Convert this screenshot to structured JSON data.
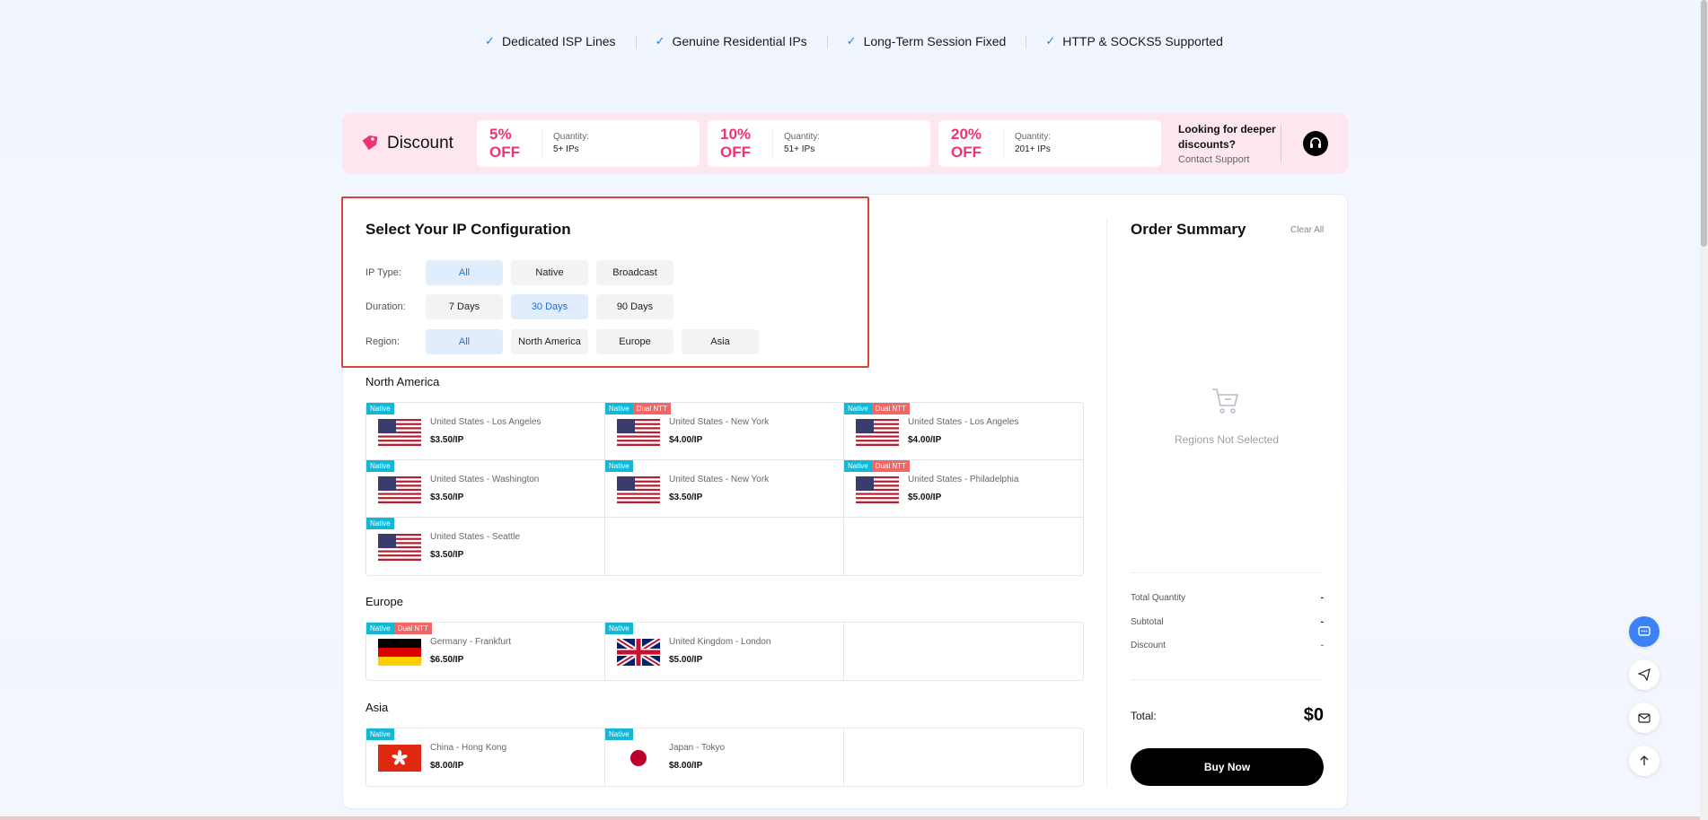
{
  "features": [
    "Dedicated ISP Lines",
    "Genuine Residential IPs",
    "Long-Term Session Fixed",
    "HTTP & SOCKS5 Supported"
  ],
  "discount": {
    "title": "Discount",
    "tiers": [
      {
        "pct": "5% OFF",
        "qty_label": "Quantity:",
        "qty": "5+ IPs"
      },
      {
        "pct": "10% OFF",
        "qty_label": "Quantity:",
        "qty": "51+ IPs"
      },
      {
        "pct": "20% OFF",
        "qty_label": "Quantity:",
        "qty": "201+ IPs"
      }
    ],
    "deeper_title": "Looking for deeper discounts?",
    "contact": "Contact Support"
  },
  "config": {
    "title": "Select Your IP Configuration",
    "ip_type": {
      "label": "IP Type:",
      "options": [
        "All",
        "Native",
        "Broadcast"
      ],
      "selected": "All"
    },
    "duration": {
      "label": "Duration:",
      "options": [
        "7 Days",
        "30 Days",
        "90 Days"
      ],
      "selected": "30 Days"
    },
    "region": {
      "label": "Region:",
      "options": [
        "All",
        "North America",
        "Europe",
        "Asia"
      ],
      "selected": "All"
    }
  },
  "regions": [
    {
      "name": "North America",
      "items": [
        {
          "city": "United States - Los Angeles",
          "price": "$3.50/IP",
          "native": "Native",
          "dual": "",
          "flag": "us"
        },
        {
          "city": "United States - New York",
          "price": "$4.00/IP",
          "native": "Native",
          "dual": "Dual NTT",
          "flag": "us"
        },
        {
          "city": "United States - Los Angeles",
          "price": "$4.00/IP",
          "native": "Native",
          "dual": "Dual NTT",
          "flag": "us"
        },
        {
          "city": "United States - Washington",
          "price": "$3.50/IP",
          "native": "Native",
          "dual": "",
          "flag": "us"
        },
        {
          "city": "United States - New York",
          "price": "$3.50/IP",
          "native": "Native",
          "dual": "",
          "flag": "us"
        },
        {
          "city": "United States - Philadelphia",
          "price": "$5.00/IP",
          "native": "Native",
          "dual": "Dual NTT",
          "flag": "us"
        },
        {
          "city": "United States - Seattle",
          "price": "$3.50/IP",
          "native": "Native",
          "dual": "",
          "flag": "us"
        }
      ]
    },
    {
      "name": "Europe",
      "items": [
        {
          "city": "Germany - Frankfurt",
          "price": "$6.50/IP",
          "native": "Native",
          "dual": "Dual NTT",
          "flag": "de"
        },
        {
          "city": "United Kingdom - London",
          "price": "$5.00/IP",
          "native": "Native",
          "dual": "",
          "flag": "gb"
        }
      ]
    },
    {
      "name": "Asia",
      "items": [
        {
          "city": "China - Hong Kong",
          "price": "$8.00/IP",
          "native": "Native",
          "dual": "",
          "flag": "hk"
        },
        {
          "city": "Japan - Tokyo",
          "price": "$8.00/IP",
          "native": "Native",
          "dual": "",
          "flag": "jp"
        }
      ]
    }
  ],
  "summary": {
    "title": "Order Summary",
    "clear": "Clear All",
    "empty": "Regions Not Selected",
    "total_quantity_label": "Total Quantity",
    "total_quantity": "-",
    "subtotal_label": "Subtotal",
    "subtotal": "-",
    "discount_label": "Discount",
    "discount": "-",
    "total_label": "Total:",
    "total": "$0",
    "buy": "Buy Now"
  },
  "colors": {
    "accent": "#1f6fe0",
    "pink": "#f0336f",
    "native_badge": "#16b7d4",
    "dual_badge": "#f26666",
    "highlight": "#e0403a"
  }
}
